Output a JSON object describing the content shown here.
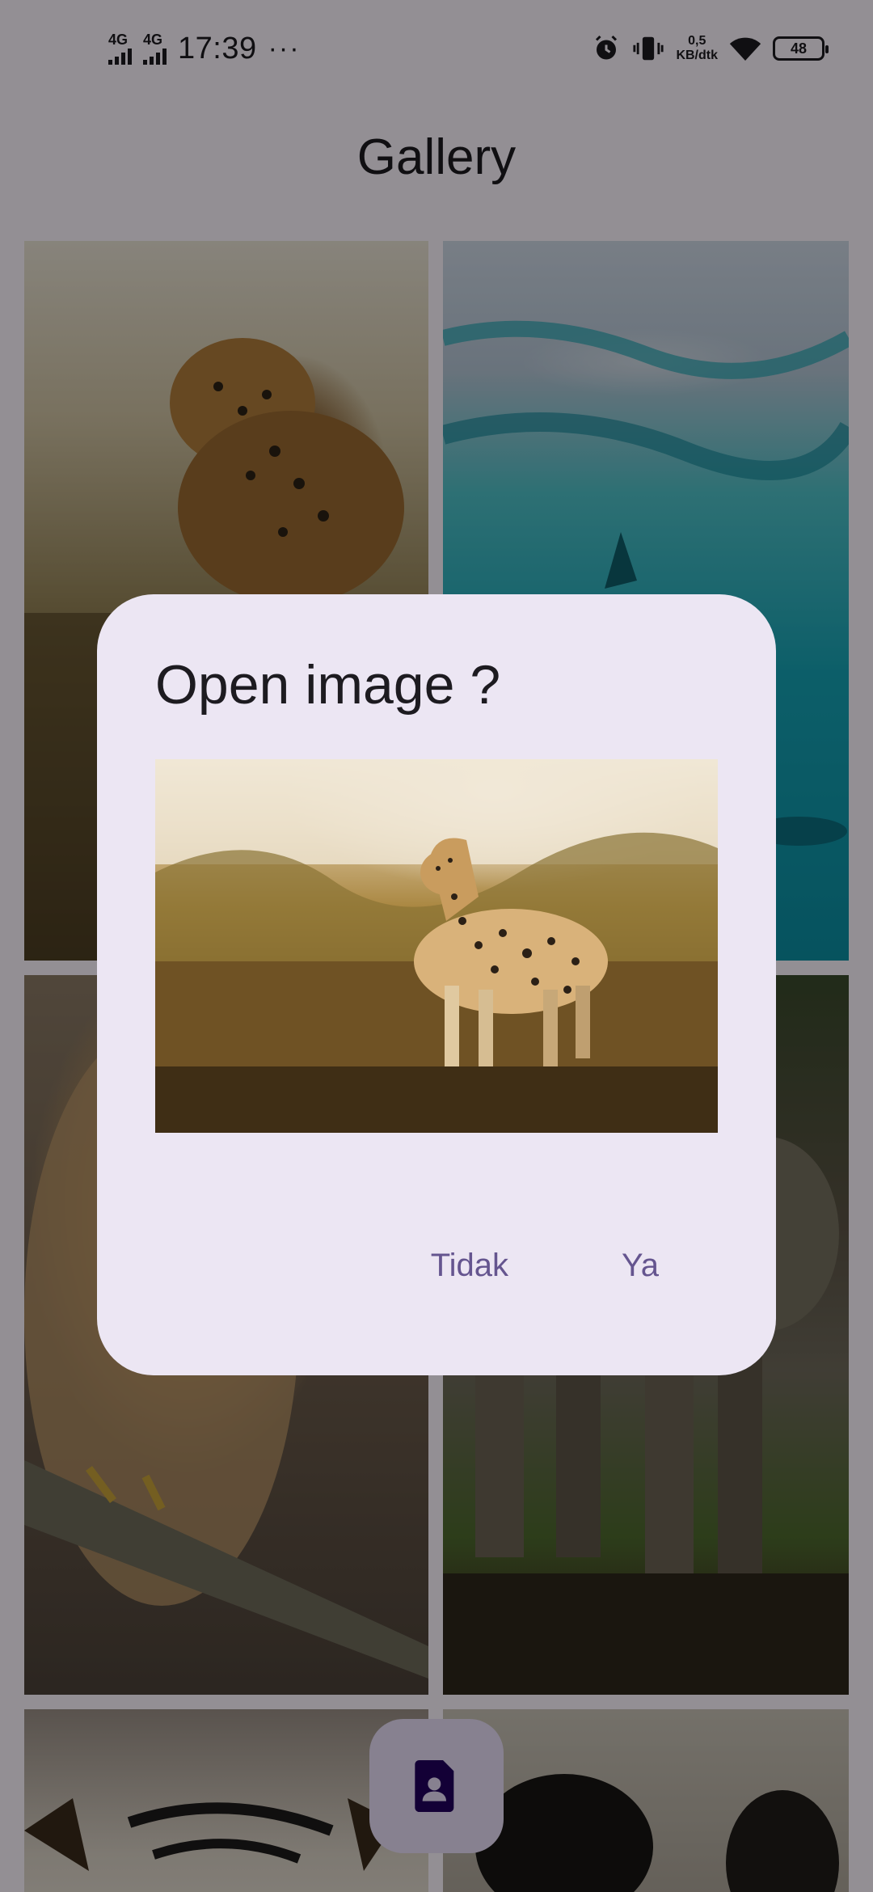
{
  "status_bar": {
    "sim1": "4G",
    "sim2": "4G",
    "time": "17:39",
    "overflow": "···",
    "net_speed_value": "0,5",
    "net_speed_unit": "KB/dtk",
    "battery": "48",
    "icons": [
      "alarm-icon",
      "vibrate-icon",
      "wifi-icon",
      "battery-icon"
    ]
  },
  "app_bar": {
    "title": "Gallery"
  },
  "gallery": {
    "tiles": [
      {
        "subject": "leopard"
      },
      {
        "subject": "ocean"
      },
      {
        "subject": "eagle"
      },
      {
        "subject": "elephants"
      },
      {
        "subject": "tiger"
      },
      {
        "subject": "zebra"
      }
    ]
  },
  "fab": {
    "icon": "contact-file-icon"
  },
  "dialog": {
    "title": "Open image ?",
    "cancel_label": "Tidak",
    "confirm_label": "Ya"
  },
  "colors": {
    "dialog_bg": "#ece6f3",
    "button_text": "#65558f",
    "fab_bg": "#e8def8",
    "fab_icon": "#21005d"
  }
}
